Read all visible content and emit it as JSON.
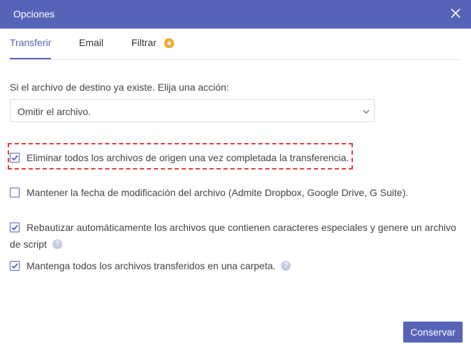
{
  "dialog": {
    "title": "Opciones"
  },
  "tabs": [
    {
      "label": "Transferir",
      "active": true
    },
    {
      "label": "Email",
      "active": false
    },
    {
      "label": "Filtrar",
      "active": false
    }
  ],
  "prompt": "Si el archivo de destino ya existe. Elija una acción:",
  "select": {
    "value": "Omitir el archivo."
  },
  "options": [
    {
      "label": "Eliminar todos los archivos de origen una vez completada la transferencia.",
      "checked": true
    },
    {
      "label": "Mantener la fecha de modificación del archivo (Admite Dropbox, Google Drive, G Suite).",
      "checked": false
    },
    {
      "label_line1": "Rebautizar automáticamente los archivos que contienen caracteres especiales y genere un archivo",
      "label_line2": "de script",
      "checked": true
    },
    {
      "label": "Mantenga todos los archivos transferidos en una carpeta.",
      "checked": true
    }
  ],
  "save_label": "Conservar",
  "colors": {
    "accent": "#5663b6",
    "highlight": "#e23a3a",
    "star": "#f5a623"
  },
  "icons": [
    "close-icon",
    "star-icon",
    "chevron-down-icon",
    "checkmark-icon",
    "help-icon"
  ]
}
